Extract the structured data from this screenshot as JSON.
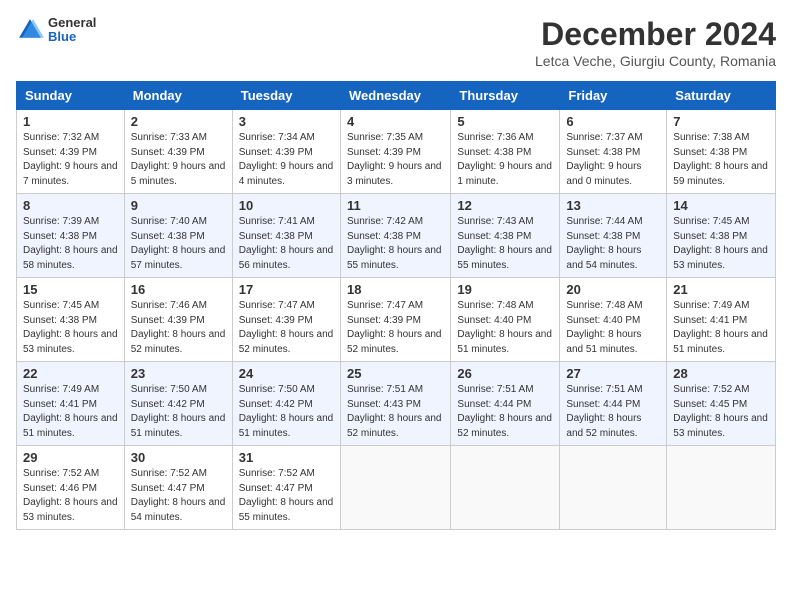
{
  "logo": {
    "general": "General",
    "blue": "Blue"
  },
  "title": "December 2024",
  "location": "Letca Veche, Giurgiu County, Romania",
  "headers": [
    "Sunday",
    "Monday",
    "Tuesday",
    "Wednesday",
    "Thursday",
    "Friday",
    "Saturday"
  ],
  "weeks": [
    [
      {
        "day": "1",
        "sunrise": "7:32 AM",
        "sunset": "4:39 PM",
        "daylight": "9 hours and 7 minutes."
      },
      {
        "day": "2",
        "sunrise": "7:33 AM",
        "sunset": "4:39 PM",
        "daylight": "9 hours and 5 minutes."
      },
      {
        "day": "3",
        "sunrise": "7:34 AM",
        "sunset": "4:39 PM",
        "daylight": "9 hours and 4 minutes."
      },
      {
        "day": "4",
        "sunrise": "7:35 AM",
        "sunset": "4:39 PM",
        "daylight": "9 hours and 3 minutes."
      },
      {
        "day": "5",
        "sunrise": "7:36 AM",
        "sunset": "4:38 PM",
        "daylight": "9 hours and 1 minute."
      },
      {
        "day": "6",
        "sunrise": "7:37 AM",
        "sunset": "4:38 PM",
        "daylight": "9 hours and 0 minutes."
      },
      {
        "day": "7",
        "sunrise": "7:38 AM",
        "sunset": "4:38 PM",
        "daylight": "8 hours and 59 minutes."
      }
    ],
    [
      {
        "day": "8",
        "sunrise": "7:39 AM",
        "sunset": "4:38 PM",
        "daylight": "8 hours and 58 minutes."
      },
      {
        "day": "9",
        "sunrise": "7:40 AM",
        "sunset": "4:38 PM",
        "daylight": "8 hours and 57 minutes."
      },
      {
        "day": "10",
        "sunrise": "7:41 AM",
        "sunset": "4:38 PM",
        "daylight": "8 hours and 56 minutes."
      },
      {
        "day": "11",
        "sunrise": "7:42 AM",
        "sunset": "4:38 PM",
        "daylight": "8 hours and 55 minutes."
      },
      {
        "day": "12",
        "sunrise": "7:43 AM",
        "sunset": "4:38 PM",
        "daylight": "8 hours and 55 minutes."
      },
      {
        "day": "13",
        "sunrise": "7:44 AM",
        "sunset": "4:38 PM",
        "daylight": "8 hours and 54 minutes."
      },
      {
        "day": "14",
        "sunrise": "7:45 AM",
        "sunset": "4:38 PM",
        "daylight": "8 hours and 53 minutes."
      }
    ],
    [
      {
        "day": "15",
        "sunrise": "7:45 AM",
        "sunset": "4:38 PM",
        "daylight": "8 hours and 53 minutes."
      },
      {
        "day": "16",
        "sunrise": "7:46 AM",
        "sunset": "4:39 PM",
        "daylight": "8 hours and 52 minutes."
      },
      {
        "day": "17",
        "sunrise": "7:47 AM",
        "sunset": "4:39 PM",
        "daylight": "8 hours and 52 minutes."
      },
      {
        "day": "18",
        "sunrise": "7:47 AM",
        "sunset": "4:39 PM",
        "daylight": "8 hours and 52 minutes."
      },
      {
        "day": "19",
        "sunrise": "7:48 AM",
        "sunset": "4:40 PM",
        "daylight": "8 hours and 51 minutes."
      },
      {
        "day": "20",
        "sunrise": "7:48 AM",
        "sunset": "4:40 PM",
        "daylight": "8 hours and 51 minutes."
      },
      {
        "day": "21",
        "sunrise": "7:49 AM",
        "sunset": "4:41 PM",
        "daylight": "8 hours and 51 minutes."
      }
    ],
    [
      {
        "day": "22",
        "sunrise": "7:49 AM",
        "sunset": "4:41 PM",
        "daylight": "8 hours and 51 minutes."
      },
      {
        "day": "23",
        "sunrise": "7:50 AM",
        "sunset": "4:42 PM",
        "daylight": "8 hours and 51 minutes."
      },
      {
        "day": "24",
        "sunrise": "7:50 AM",
        "sunset": "4:42 PM",
        "daylight": "8 hours and 51 minutes."
      },
      {
        "day": "25",
        "sunrise": "7:51 AM",
        "sunset": "4:43 PM",
        "daylight": "8 hours and 52 minutes."
      },
      {
        "day": "26",
        "sunrise": "7:51 AM",
        "sunset": "4:44 PM",
        "daylight": "8 hours and 52 minutes."
      },
      {
        "day": "27",
        "sunrise": "7:51 AM",
        "sunset": "4:44 PM",
        "daylight": "8 hours and 52 minutes."
      },
      {
        "day": "28",
        "sunrise": "7:52 AM",
        "sunset": "4:45 PM",
        "daylight": "8 hours and 53 minutes."
      }
    ],
    [
      {
        "day": "29",
        "sunrise": "7:52 AM",
        "sunset": "4:46 PM",
        "daylight": "8 hours and 53 minutes."
      },
      {
        "day": "30",
        "sunrise": "7:52 AM",
        "sunset": "4:47 PM",
        "daylight": "8 hours and 54 minutes."
      },
      {
        "day": "31",
        "sunrise": "7:52 AM",
        "sunset": "4:47 PM",
        "daylight": "8 hours and 55 minutes."
      },
      null,
      null,
      null,
      null
    ]
  ]
}
